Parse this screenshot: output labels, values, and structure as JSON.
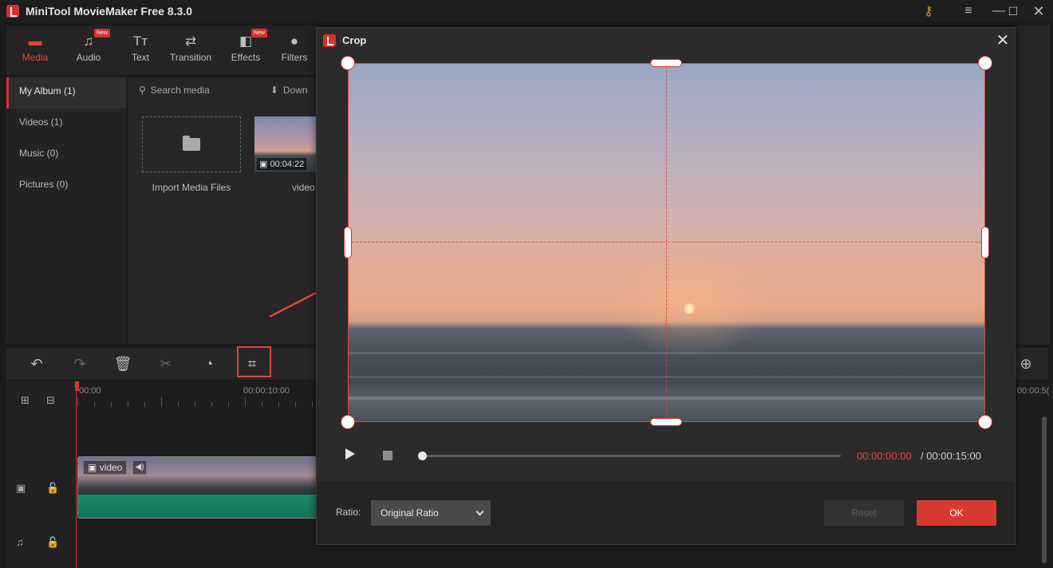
{
  "app": {
    "title": "MiniTool MovieMaker Free 8.3.0"
  },
  "toolbar": {
    "items": [
      {
        "label": "Media",
        "icon": "media-folder-icon",
        "new": false
      },
      {
        "label": "Audio",
        "icon": "music-note-icon",
        "new": true
      },
      {
        "label": "Text",
        "icon": "text-icon",
        "new": false
      },
      {
        "label": "Transition",
        "icon": "transition-arrows-icon",
        "new": false
      },
      {
        "label": "Effects",
        "icon": "effects-icon",
        "new": true
      },
      {
        "label": "Filters",
        "icon": "filters-icon",
        "new": false
      }
    ],
    "new_badge": "New"
  },
  "sidebar": {
    "items": [
      {
        "label": "My Album (1)"
      },
      {
        "label": "Videos (1)"
      },
      {
        "label": "Music (0)"
      },
      {
        "label": "Pictures (0)"
      }
    ]
  },
  "media": {
    "search_placeholder": "Search media",
    "download_label": "Down",
    "import_label": "Import Media Files",
    "video_duration": "00:04:22",
    "video_label": "video"
  },
  "timeline": {
    "ruler": [
      "00:00",
      "00:00:10:00",
      "00:00:5("
    ],
    "clip_label": "video"
  },
  "crop_dialog": {
    "title": "Crop",
    "time_current": "00:00:00:00",
    "time_total": " / 00:00:15:00",
    "seek_progress": 0,
    "ratio_label": "Ratio:",
    "ratio_value": "Original Ratio",
    "reset_label": "Reset",
    "ok_label": "OK"
  },
  "colors": {
    "accent": "#d8312d",
    "ok_button": "#d83a32",
    "time_current": "#e0453c"
  }
}
